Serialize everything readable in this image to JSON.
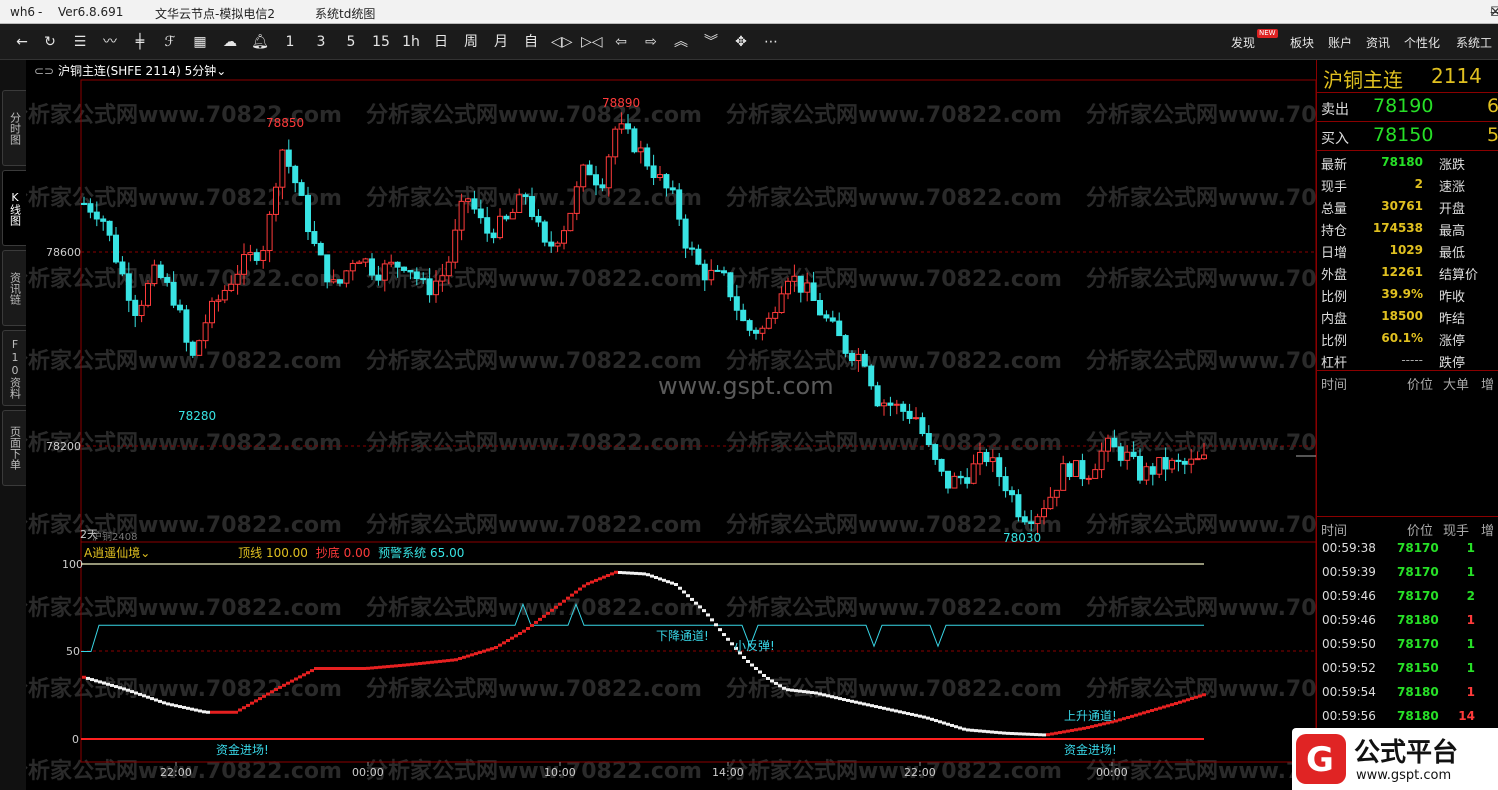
{
  "titlebar": {
    "app": "wh6",
    "version": "Ver6.8.691",
    "server": "文华云节点-模拟电信2",
    "system": "系统td统图"
  },
  "toolbar": {
    "icons": [
      "back-arrow",
      "refresh",
      "list",
      "line-chart",
      "candle",
      "cross-candle",
      "grid",
      "cloud",
      "bell"
    ],
    "periods": [
      "1",
      "3",
      "5",
      "15",
      "1h",
      "日",
      "周",
      "月",
      "自"
    ],
    "right": [
      "发现",
      "板块",
      "账户",
      "资讯",
      "个性化",
      "系统工"
    ],
    "new_badge": "NEW"
  },
  "left_tabs": [
    "分时图",
    "K线图",
    "资讯链",
    "F10资料",
    "页面下单"
  ],
  "chart": {
    "symbol": "沪铜主连(SHFE 2114)",
    "period": "5分钟",
    "watermark": "分析家公式网www.70822.com",
    "center_watermark": "www.gspt.com",
    "price_labels": [
      "78600",
      "78200"
    ],
    "high_labels": [
      "78850",
      "78890"
    ],
    "low_labels": [
      "78280",
      "78030"
    ],
    "bottom_left_label": "2天",
    "contract_label": "沪铜2408",
    "indicator": {
      "name": "A逍遥仙境",
      "items": [
        {
          "k": "顶线",
          "v": "100.00"
        },
        {
          "k": "抄底",
          "v": "0.00"
        },
        {
          "k": "预警系统",
          "v": "65.00"
        }
      ],
      "yticks": [
        "100",
        "50",
        "0"
      ],
      "annotations": [
        "下降通道!",
        "小反弹!",
        "上升通道!",
        "资金进场!",
        "资金进场!"
      ]
    },
    "xticks": [
      "22:00",
      "00:00",
      "10:00",
      "14:00",
      "22:00",
      "00:00"
    ],
    "colors": {
      "up": "#ff3b3b",
      "down": "#38e4e4",
      "grid": "#8b0000",
      "gold": "#e0c020"
    }
  },
  "chart_data": {
    "type": "candlestick",
    "symbol": "沪铜主连",
    "marked_high": 78890,
    "marked_low": 78030,
    "ylim_approx": [
      78000,
      78950
    ],
    "indicator_range": [
      0,
      100
    ],
    "indicator_warning_line": 65
  },
  "quote": {
    "name": "沪铜主连",
    "code": "2114",
    "ask": {
      "k": "卖出",
      "v": "78190",
      "q": "6"
    },
    "bid": {
      "k": "买入",
      "v": "78150",
      "q": "5"
    },
    "rows": [
      {
        "k1": "最新",
        "v1": "78180",
        "k2": "涨跌"
      },
      {
        "k1": "现手",
        "v1": "2",
        "k2": "速涨"
      },
      {
        "k1": "总量",
        "v1": "30761",
        "k2": "开盘"
      },
      {
        "k1": "持仓",
        "v1": "174538",
        "k2": "最高"
      },
      {
        "k1": "日增",
        "v1": "1029",
        "k2": "最低"
      },
      {
        "k1": "外盘",
        "v1": "12261",
        "k2": "结算价"
      },
      {
        "k1": "比例",
        "v1": "39.9%",
        "k2": "昨收"
      },
      {
        "k1": "内盘",
        "v1": "18500",
        "k2": "昨结"
      },
      {
        "k1": "比例",
        "v1": "60.1%",
        "k2": "涨停"
      },
      {
        "k1": "杠杆",
        "v1": "-----",
        "k2": "跌停"
      }
    ],
    "block_header": [
      "时间",
      "价位",
      "大单",
      "增"
    ],
    "tick_header": [
      "时间",
      "价位",
      "现手",
      "增"
    ],
    "ticks": [
      {
        "t": "00:59:38",
        "p": "78170",
        "n": "1",
        "c": "#27e027"
      },
      {
        "t": "00:59:39",
        "p": "78170",
        "n": "1",
        "c": "#27e027"
      },
      {
        "t": "00:59:46",
        "p": "78170",
        "n": "2",
        "c": "#27e027"
      },
      {
        "t": "00:59:46",
        "p": "78180",
        "n": "1",
        "c": "#ff3b3b"
      },
      {
        "t": "00:59:50",
        "p": "78170",
        "n": "1",
        "c": "#27e027"
      },
      {
        "t": "00:59:52",
        "p": "78150",
        "n": "1",
        "c": "#27e027"
      },
      {
        "t": "00:59:54",
        "p": "78180",
        "n": "1",
        "c": "#ff3b3b"
      },
      {
        "t": "00:59:56",
        "p": "78180",
        "n": "14",
        "c": "#ff3b3b"
      }
    ]
  },
  "logo": {
    "mark": "G",
    "title": "公式平台",
    "url": "www.gspt.com"
  }
}
